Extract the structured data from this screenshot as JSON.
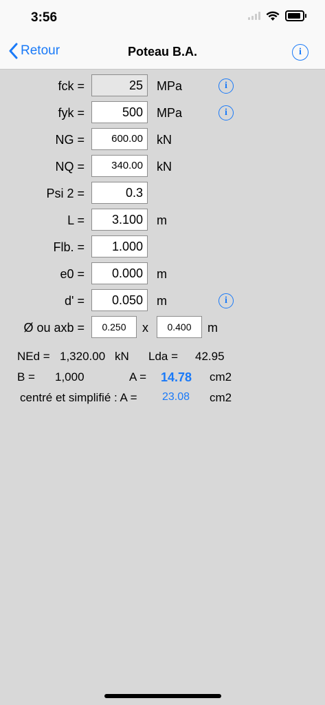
{
  "status": {
    "time": "3:56"
  },
  "nav": {
    "back_label": "Retour",
    "title": "Poteau B.A.",
    "info_glyph": "i"
  },
  "inputs": {
    "fck": {
      "label": "fck =",
      "value": "25",
      "unit": "MPa"
    },
    "fyk": {
      "label": "fyk =",
      "value": "500",
      "unit": "MPa"
    },
    "ng": {
      "label": "NG =",
      "value": "600.00",
      "unit": "kN"
    },
    "nq": {
      "label": "NQ =",
      "value": "340.00",
      "unit": "kN"
    },
    "psi2": {
      "label": "Psi 2 =",
      "value": "0.3",
      "unit": ""
    },
    "l": {
      "label": "L =",
      "value": "3.100",
      "unit": "m"
    },
    "flb": {
      "label": "Flb. =",
      "value": "1.000",
      "unit": ""
    },
    "e0": {
      "label": "e0 =",
      "value": "0.000",
      "unit": "m"
    },
    "d": {
      "label": "d' =",
      "value": "0.050",
      "unit": "m"
    },
    "dim": {
      "label": "Ø ou axb =",
      "a": "0.250",
      "sep": "x",
      "b": "0.400",
      "unit": "m"
    }
  },
  "results": {
    "ned_label": "NEd =",
    "ned_value": "1,320.00",
    "ned_unit": "kN",
    "lda_label": "Lda =",
    "lda_value": "42.95",
    "b_label": "B =",
    "b_value": "1,000",
    "a_label": "A =",
    "a_value": "14.78",
    "a_unit": "cm2",
    "simple_label": "centré et simplifié : A =",
    "simple_value": "23.08",
    "simple_unit": "cm2"
  },
  "colors": {
    "accent": "#1a7af8",
    "background": "#d8d8d8"
  },
  "icons": [
    "back-chevron-icon",
    "info-icon",
    "wifi-icon",
    "battery-icon",
    "signal-icon"
  ]
}
